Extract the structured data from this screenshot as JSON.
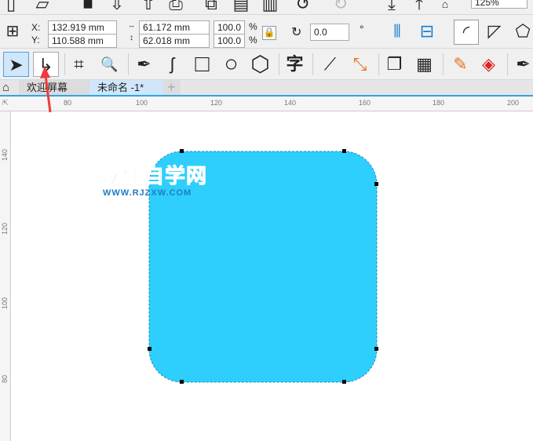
{
  "toolbar_top": {
    "zoom": "125%"
  },
  "property_bar": {
    "x_label": "X:",
    "y_label": "Y:",
    "x": "132.919 mm",
    "y": "110.588 mm",
    "width": "61.172 mm",
    "height": "62.018 mm",
    "scale_w": "100.0",
    "scale_h": "100.0",
    "percent": "%",
    "rotation": "0.0",
    "degree": "°"
  },
  "toolbox": [
    {
      "name": "pick-tool",
      "glyph": "➤"
    },
    {
      "name": "shape-tool",
      "glyph": "↳"
    },
    {
      "name": "crop-tool",
      "glyph": "⌗"
    },
    {
      "name": "zoom-tool",
      "glyph": "🔍"
    },
    {
      "name": "pen-tool",
      "glyph": "✒"
    },
    {
      "name": "artistic-media-tool",
      "glyph": "ʃ"
    },
    {
      "name": "rectangle-tool",
      "glyph": "□"
    },
    {
      "name": "ellipse-tool",
      "glyph": "○"
    },
    {
      "name": "polygon-tool",
      "glyph": "⬡"
    },
    {
      "name": "text-tool",
      "glyph": "字"
    },
    {
      "name": "dimension-tool",
      "glyph": "⟋"
    },
    {
      "name": "connector-tool",
      "glyph": "⤡"
    },
    {
      "name": "drop-shadow-tool",
      "glyph": "❐"
    },
    {
      "name": "transparency-tool",
      "glyph": "▦"
    },
    {
      "name": "eyedropper-tool",
      "glyph": "✎"
    },
    {
      "name": "fill-tool",
      "glyph": "◈"
    },
    {
      "name": "outline-pen-tool",
      "glyph": "✒"
    }
  ],
  "tabs": {
    "welcome": "欢迎屏幕",
    "document": "未命名 -1*",
    "add": "+"
  },
  "ruler": {
    "h": [
      "80",
      "100",
      "120",
      "140",
      "160",
      "180",
      "200"
    ],
    "v": [
      "140",
      "120",
      "100",
      "80"
    ]
  },
  "watermark": {
    "title": "软件自学网",
    "url": "WWW.RJZXW.COM"
  },
  "colors": {
    "shape_fill": "#2ecffc",
    "accent": "#2ba6e8",
    "arrow": "#ef3b3b"
  }
}
